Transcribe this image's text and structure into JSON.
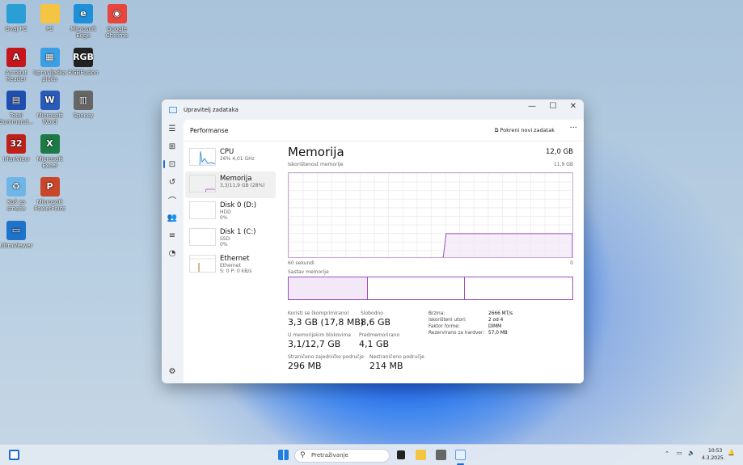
{
  "desktop_icons": [
    {
      "label": "Ovaj PC",
      "icon": "monitor-icon",
      "color": "#2a9fd6"
    },
    {
      "label": "PC",
      "icon": "folder-icon",
      "color": "#f4c542"
    },
    {
      "label": "Microsoft Edge",
      "icon": "edge-icon",
      "color": "#1f8fd8"
    },
    {
      "label": "Google Chrome",
      "icon": "chrome-icon",
      "color": "#e8453c"
    },
    {
      "label": "Acrobat Reader",
      "icon": "acrobat-icon",
      "color": "#c4161c"
    },
    {
      "label": "Upravljačka ploča",
      "icon": "control-panel-icon",
      "color": "#3aa0e6"
    },
    {
      "label": "RGBFusion",
      "icon": "rgb-icon",
      "color": "#222222"
    },
    {
      "label": "Total Command...",
      "icon": "floppy-icon",
      "color": "#1e4fb0"
    },
    {
      "label": "Microsoft Word",
      "icon": "word-icon",
      "color": "#2b5bb8"
    },
    {
      "label": "Speccy",
      "icon": "speccy-icon",
      "color": "#666666"
    },
    {
      "label": "IrfanView",
      "icon": "irfanview-icon",
      "color": "#c0201c"
    },
    {
      "label": "Microsoft Excel",
      "icon": "excel-icon",
      "color": "#1d7a45"
    },
    {
      "label": "Koš za smeće",
      "icon": "recycle-bin-icon",
      "color": "#6fb6e8"
    },
    {
      "label": "Microsoft PowerPoint",
      "icon": "powerpoint-icon",
      "color": "#c9462b"
    },
    {
      "label": "UltraViewer",
      "icon": "ultraviewer-icon",
      "color": "#1e72c8"
    }
  ],
  "window": {
    "title": "Upravitelj zadataka",
    "minimize": "—",
    "maximize": "☐",
    "close": "✕"
  },
  "header": {
    "title": "Performanse",
    "new_task": "Pokreni novi zadatak",
    "more": "···"
  },
  "resources": [
    {
      "name": "CPU",
      "sub1": "26% 4,01 GHz",
      "sub2": ""
    },
    {
      "name": "Memorija",
      "sub1": "3,3/11,9 GB (28%)",
      "sub2": ""
    },
    {
      "name": "Disk 0 (D:)",
      "sub1": "HDD",
      "sub2": "0%"
    },
    {
      "name": "Disk 1 (C:)",
      "sub1": "SSD",
      "sub2": "0%"
    },
    {
      "name": "Ethernet",
      "sub1": "Ethernet",
      "sub2": "S: 0 P: 0 kB/s"
    }
  ],
  "main": {
    "title": "Memorija",
    "total": "12,0 GB",
    "usage_label": "Iskorištenost memorije",
    "usage_max": "11,9 GB",
    "time_label": "60 sekundi",
    "time_end": "0",
    "composition_label": "Sastav memorije",
    "usage_percent": 28,
    "stats": [
      {
        "label": "Koristi se (komprimirano)",
        "value": "3,3 GB (17,8 MB)"
      },
      {
        "label": "Slobodno",
        "value": "8,6 GB"
      },
      {
        "label": "U memorijskim blokovima",
        "value": "3,1/12,7 GB"
      },
      {
        "label": "Predmemorirano",
        "value": "4,1 GB"
      },
      {
        "label": "Straničeno zajedničko područje",
        "value": "296 MB"
      },
      {
        "label": "Nestraničeno područje",
        "value": "214 MB"
      }
    ],
    "specs": [
      {
        "label": "Brzina:",
        "value": "2666 MT/s"
      },
      {
        "label": "Iskorišteni utori:",
        "value": "2 od 4"
      },
      {
        "label": "Faktor forme:",
        "value": "DIMM"
      },
      {
        "label": "Rezervirano za hardver:",
        "value": "57,0 MB"
      }
    ]
  },
  "taskbar": {
    "search_placeholder": "Pretraživanje",
    "time": "10:53",
    "date": "4.3.2025."
  },
  "colors": {
    "memory": "#9c4fc0",
    "accent": "#1a6dd0"
  }
}
